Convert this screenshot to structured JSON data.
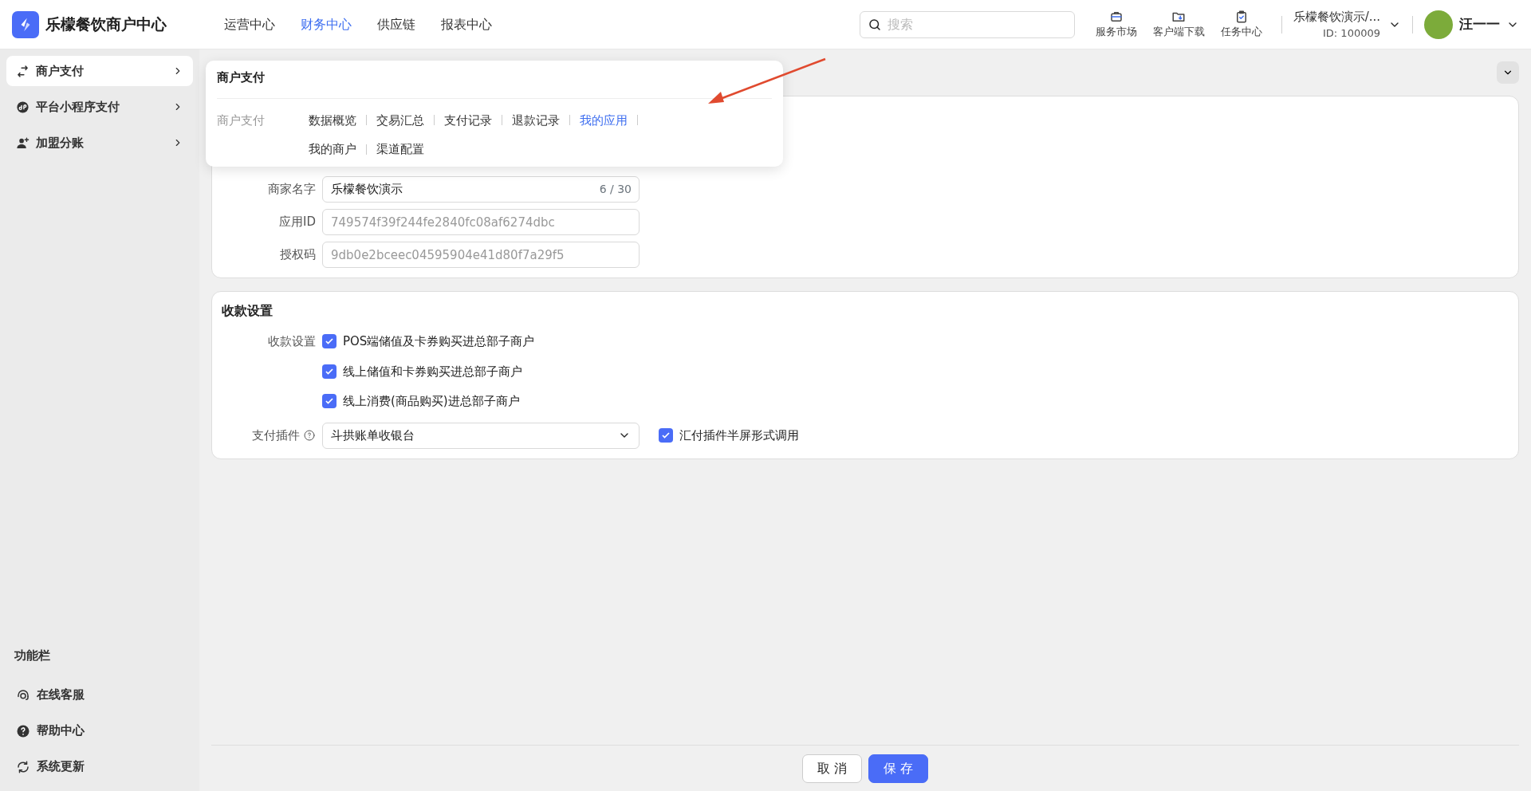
{
  "app": {
    "title": "乐檬餐饮商户中心"
  },
  "top_nav": [
    {
      "label": "运营中心",
      "selected": false
    },
    {
      "label": "财务中心",
      "selected": true
    },
    {
      "label": "供应链",
      "selected": false
    },
    {
      "label": "报表中心",
      "selected": false
    }
  ],
  "search": {
    "placeholder": "搜索"
  },
  "toolbar": [
    {
      "label": "服务市场",
      "kind": "market"
    },
    {
      "label": "客户端下载",
      "kind": "download"
    },
    {
      "label": "任务中心",
      "kind": "tasks"
    }
  ],
  "account": {
    "name": "乐檬餐饮演示/...",
    "id": "ID: 100009"
  },
  "user": {
    "name": "汪一一"
  },
  "sidebar": {
    "items": [
      {
        "label": "商户支付",
        "kind": "exchange",
        "selected": true
      },
      {
        "label": "平台小程序支付",
        "kind": "miniapp",
        "selected": false
      },
      {
        "label": "加盟分账",
        "kind": "user-add",
        "selected": false
      }
    ],
    "footer_title": "功能栏",
    "footer_items": [
      {
        "label": "在线客服",
        "kind": "headset"
      },
      {
        "label": "帮助中心",
        "kind": "help"
      },
      {
        "label": "系统更新",
        "kind": "refresh"
      }
    ]
  },
  "popover": {
    "title": "商户支付",
    "group_label": "商户支付",
    "links": [
      {
        "label": "数据概览",
        "selected": false
      },
      {
        "label": "交易汇总",
        "selected": false
      },
      {
        "label": "支付记录",
        "selected": false
      },
      {
        "label": "退款记录",
        "selected": false
      },
      {
        "label": "我的应用",
        "selected": true
      },
      {
        "label": "我的商户",
        "selected": false
      },
      {
        "label": "渠道配置",
        "selected": false
      }
    ]
  },
  "app_card": {
    "fields": [
      {
        "label": "商家名字",
        "value": "乐檬餐饮演示",
        "counter": "6 / 30",
        "disabled": false
      },
      {
        "label": "应用ID",
        "value": "749574f39f244fe2840fc08af6274dbc",
        "disabled": true
      },
      {
        "label": "授权码",
        "value": "9db0e2bceec04595904e41d80f7a29f5",
        "disabled": true
      }
    ]
  },
  "payment_card": {
    "title": "收款设置",
    "options_label": "收款设置",
    "options": [
      {
        "label": "POS端储值及卡券购买进总部子商户",
        "checked": true
      },
      {
        "label": "线上储值和卡券购买进总部子商户",
        "checked": true
      },
      {
        "label": "线上消费(商品购买)进总部子商户",
        "checked": true
      }
    ],
    "plugin": {
      "label": "支付插件",
      "value": "斗拱账单收银台",
      "option": {
        "label": "汇付插件半屏形式调用",
        "checked": true
      }
    }
  },
  "buttons": [
    {
      "label": "取 消",
      "kind": "secondary"
    },
    {
      "label": "保 存",
      "kind": "primary"
    }
  ]
}
